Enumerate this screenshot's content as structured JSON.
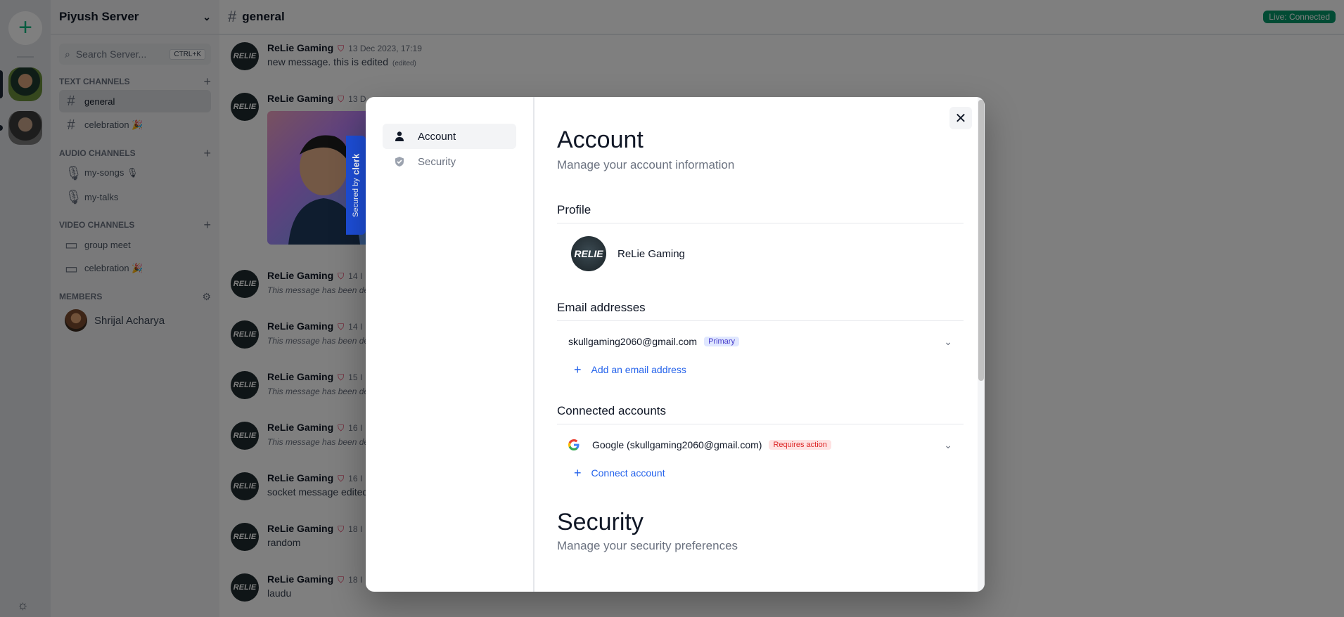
{
  "server": {
    "name": "Piyush Server",
    "search_placeholder": "Search Server...",
    "search_shortcut": "CTRL+K",
    "sections": {
      "text": "TEXT CHANNELS",
      "audio": "AUDIO CHANNELS",
      "video": "VIDEO CHANNELS",
      "members": "MEMBERS"
    },
    "text_channels": [
      "general",
      "celebration 🎉"
    ],
    "audio_channels": [
      "my-songs 🎙",
      "my-talks"
    ],
    "video_channels": [
      "group meet",
      "celebration 🎉"
    ],
    "members": [
      "Shrijal Acharya"
    ]
  },
  "chat": {
    "channel": "general",
    "live_status": "Live: Connected",
    "messages": [
      {
        "author": "ReLie Gaming",
        "time": "13 Dec 2023, 17:19",
        "text": "new message. this is edited",
        "edited": "(edited)"
      },
      {
        "author": "ReLie Gaming",
        "time": "13 D",
        "text": ""
      },
      {
        "author": "ReLie Gaming",
        "time": "14 I",
        "text": "This message has been de"
      },
      {
        "author": "ReLie Gaming",
        "time": "14 I",
        "text": "This message has been de"
      },
      {
        "author": "ReLie Gaming",
        "time": "15 I",
        "text": "This message has been de"
      },
      {
        "author": "ReLie Gaming",
        "time": "16 I",
        "text": "This message has been de"
      },
      {
        "author": "ReLie Gaming",
        "time": "16 I",
        "text": "socket message edited"
      },
      {
        "author": "ReLie Gaming",
        "time": "18 I",
        "text": "random"
      },
      {
        "author": "ReLie Gaming",
        "time": "18 I",
        "text": "laudu"
      }
    ],
    "avatar_text": "RELIE"
  },
  "clerk_badge": {
    "prefix": "Secured by",
    "brand": "clerk"
  },
  "modal": {
    "nav": {
      "account": "Account",
      "security": "Security"
    },
    "title": "Account",
    "subtitle": "Manage your account information",
    "profile": {
      "heading": "Profile",
      "name": "ReLie Gaming",
      "avatar_text": "RELIE"
    },
    "emails": {
      "heading": "Email addresses",
      "address": "skullgaming2060@gmail.com",
      "badge": "Primary",
      "add_label": "Add an email address"
    },
    "connected": {
      "heading": "Connected accounts",
      "account": "Google (skullgaming2060@gmail.com)",
      "badge": "Requires action",
      "add_label": "Connect account"
    },
    "security": {
      "title": "Security",
      "subtitle": "Manage your security preferences"
    },
    "close_label": "✕"
  }
}
